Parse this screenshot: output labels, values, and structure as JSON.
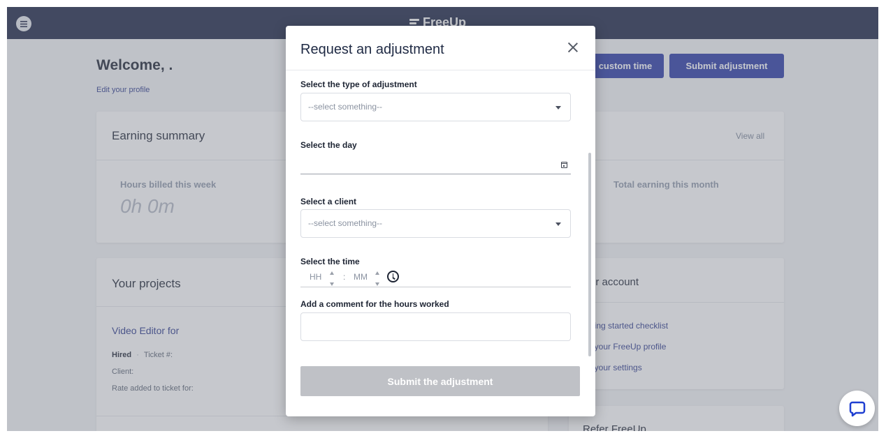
{
  "brand": {
    "name": "FreeUp"
  },
  "page": {
    "welcome": "Welcome, .",
    "edit_profile": "Edit your profile",
    "buttons": {
      "custom_time": "custom time",
      "submit_adjustment": "Submit adjustment"
    }
  },
  "earning_summary": {
    "title": "Earning summary",
    "view_all": "View all",
    "hours_label": "Hours billed this week",
    "hours_value": "0h 0m",
    "total_label": "Total earning this month"
  },
  "projects": {
    "title": "Your projects",
    "item": {
      "name": "Video Editor for",
      "status": "Hired",
      "ticket": "Ticket #:",
      "client": "Client:",
      "rate": "Rate added to ticket for:"
    }
  },
  "account": {
    "title": "ur account",
    "links": [
      "tting started checklist",
      "t your FreeUp profile",
      "t your settings"
    ]
  },
  "refer": {
    "title": "Refer FreeUp"
  },
  "modal": {
    "title": "Request an adjustment",
    "type_label": "Select the type of adjustment",
    "type_placeholder": "--select something--",
    "day_label": "Select the day",
    "client_label": "Select a client",
    "client_placeholder": "--select something--",
    "time_label": "Select the time",
    "hh_placeholder": "HH",
    "time_separator": ":",
    "mm_placeholder": "MM",
    "comment_label": "Add a comment for the hours worked",
    "submit_label": "Submit the adjustment"
  },
  "icons": {
    "menu": "hamburger-menu-icon",
    "close": "close-icon",
    "calendar": "calendar-icon",
    "clock": "clock-icon",
    "chat": "chat-bubble-icon"
  },
  "colors": {
    "topbar": "#1c2545",
    "primary_button": "#2a3aa6",
    "link": "#2c3a8c",
    "submit_disabled": "#bfc1c6"
  }
}
